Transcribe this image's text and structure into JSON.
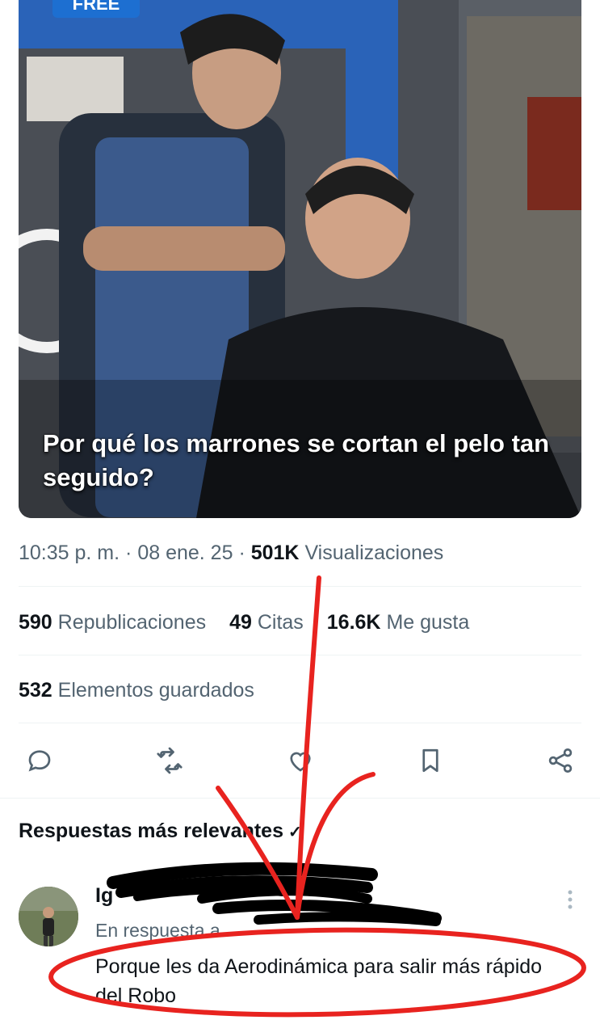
{
  "media": {
    "badge": "FREE",
    "caption": "Por qué los marrones se cortan el pelo tan seguido?"
  },
  "meta": {
    "time": "10:35 p. m.",
    "date": "08 ene. 25",
    "views_count": "501K",
    "views_label": "Visualizaciones"
  },
  "stats": {
    "reposts_count": "590",
    "reposts_label": "Republicaciones",
    "quotes_count": "49",
    "quotes_label": "Citas",
    "likes_count": "16.6K",
    "likes_label": "Me gusta",
    "bookmarks_count": "532",
    "bookmarks_label": "Elementos guardados"
  },
  "actions": [
    "reply-icon",
    "repost-icon",
    "like-icon",
    "bookmark-icon",
    "share-icon"
  ],
  "replies": {
    "title": "Respuestas más relevantes",
    "items": [
      {
        "author": "Ig",
        "reply_to": "En respuesta a",
        "text": "Porque les da Aerodinámica para salir más rápido del Robo"
      }
    ]
  },
  "colors": {
    "annotation_red": "#e8231f",
    "scribble": "#000000",
    "muted": "#536471",
    "badge": "#1d6fd1"
  }
}
